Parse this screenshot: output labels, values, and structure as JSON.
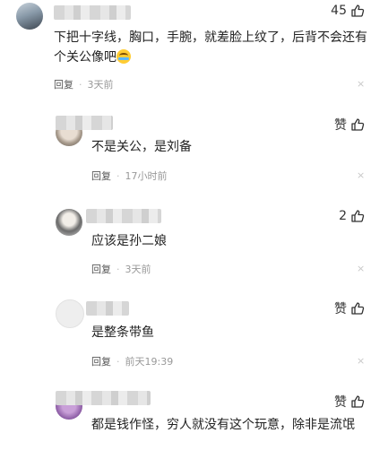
{
  "comments": [
    {
      "likes": "45",
      "text": "下把十字线，胸口，手腕，就差脸上纹了，后背不会还有个关公像吧",
      "reply": "回复",
      "time": "3天前",
      "close": "×"
    },
    {
      "likes": "赞",
      "text": "不是关公，是刘备",
      "reply": "回复",
      "time": "17小时前",
      "close": "×"
    },
    {
      "likes": "2",
      "text": "应该是孙二娘",
      "reply": "回复",
      "time": "3天前",
      "close": "×"
    },
    {
      "likes": "赞",
      "text": "是整条带鱼",
      "reply": "回复",
      "time": "前天19:39",
      "close": "×"
    },
    {
      "likes": "赞",
      "text": "都是钱作怪，穷人就没有这个玩意，除非是流氓",
      "reply": "",
      "time": "",
      "close": ""
    }
  ],
  "icons": {
    "like": "thumbs-up-icon",
    "close": "close-icon",
    "emoji": "crying-laughing-emoji-icon"
  }
}
